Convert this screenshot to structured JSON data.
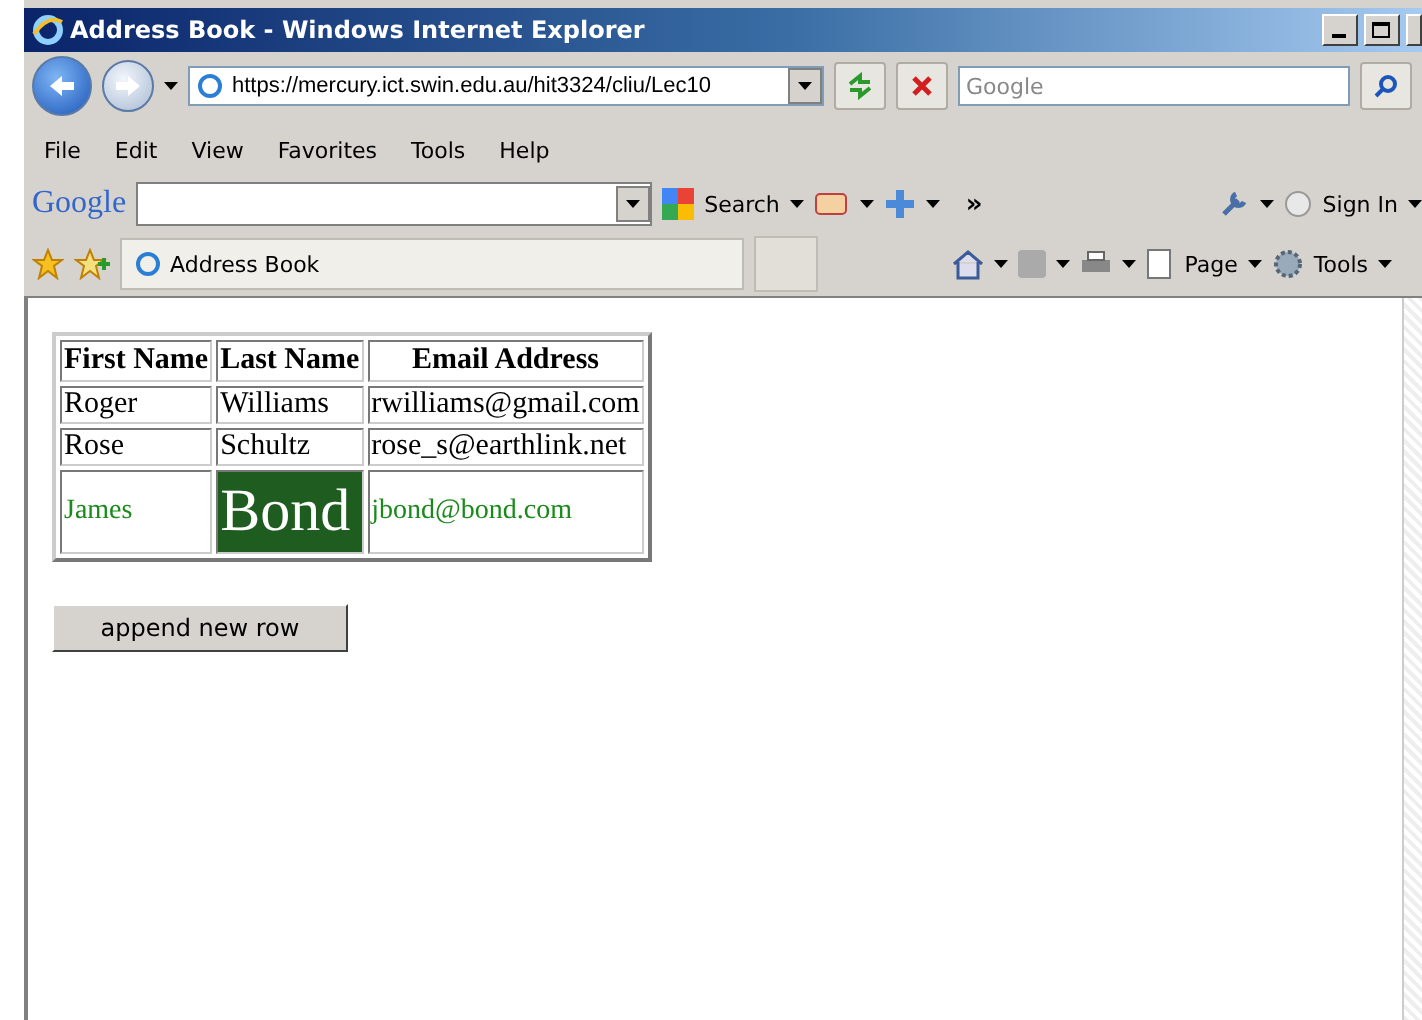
{
  "window": {
    "title": "Address Book - Windows Internet Explorer"
  },
  "address_bar": {
    "url": "https://mercury.ict.swin.edu.au/hit3324/cliu/Lec10"
  },
  "search": {
    "placeholder": "Google"
  },
  "menu": [
    "File",
    "Edit",
    "View",
    "Favorites",
    "Tools",
    "Help"
  ],
  "google_toolbar": {
    "logo": "Google",
    "search_label": "Search",
    "more": "»",
    "sign_in": "Sign In"
  },
  "favorites_bar": {
    "tab_title": "Address Book",
    "page_label": "Page",
    "tools_label": "Tools"
  },
  "table": {
    "columns": [
      "First Name",
      "Last Name",
      "Email Address"
    ],
    "rows": [
      {
        "kind": "plain",
        "cells": [
          "Roger",
          "Williams",
          "rwilliams@gmail.com"
        ]
      },
      {
        "kind": "plain",
        "cells": [
          "Rose",
          "Schultz",
          "rose_s@earthlink.net"
        ]
      },
      {
        "kind": "styled",
        "cells": [
          "James",
          "Bond",
          "jbond@bond.com"
        ]
      }
    ]
  },
  "append_button": "append new row"
}
